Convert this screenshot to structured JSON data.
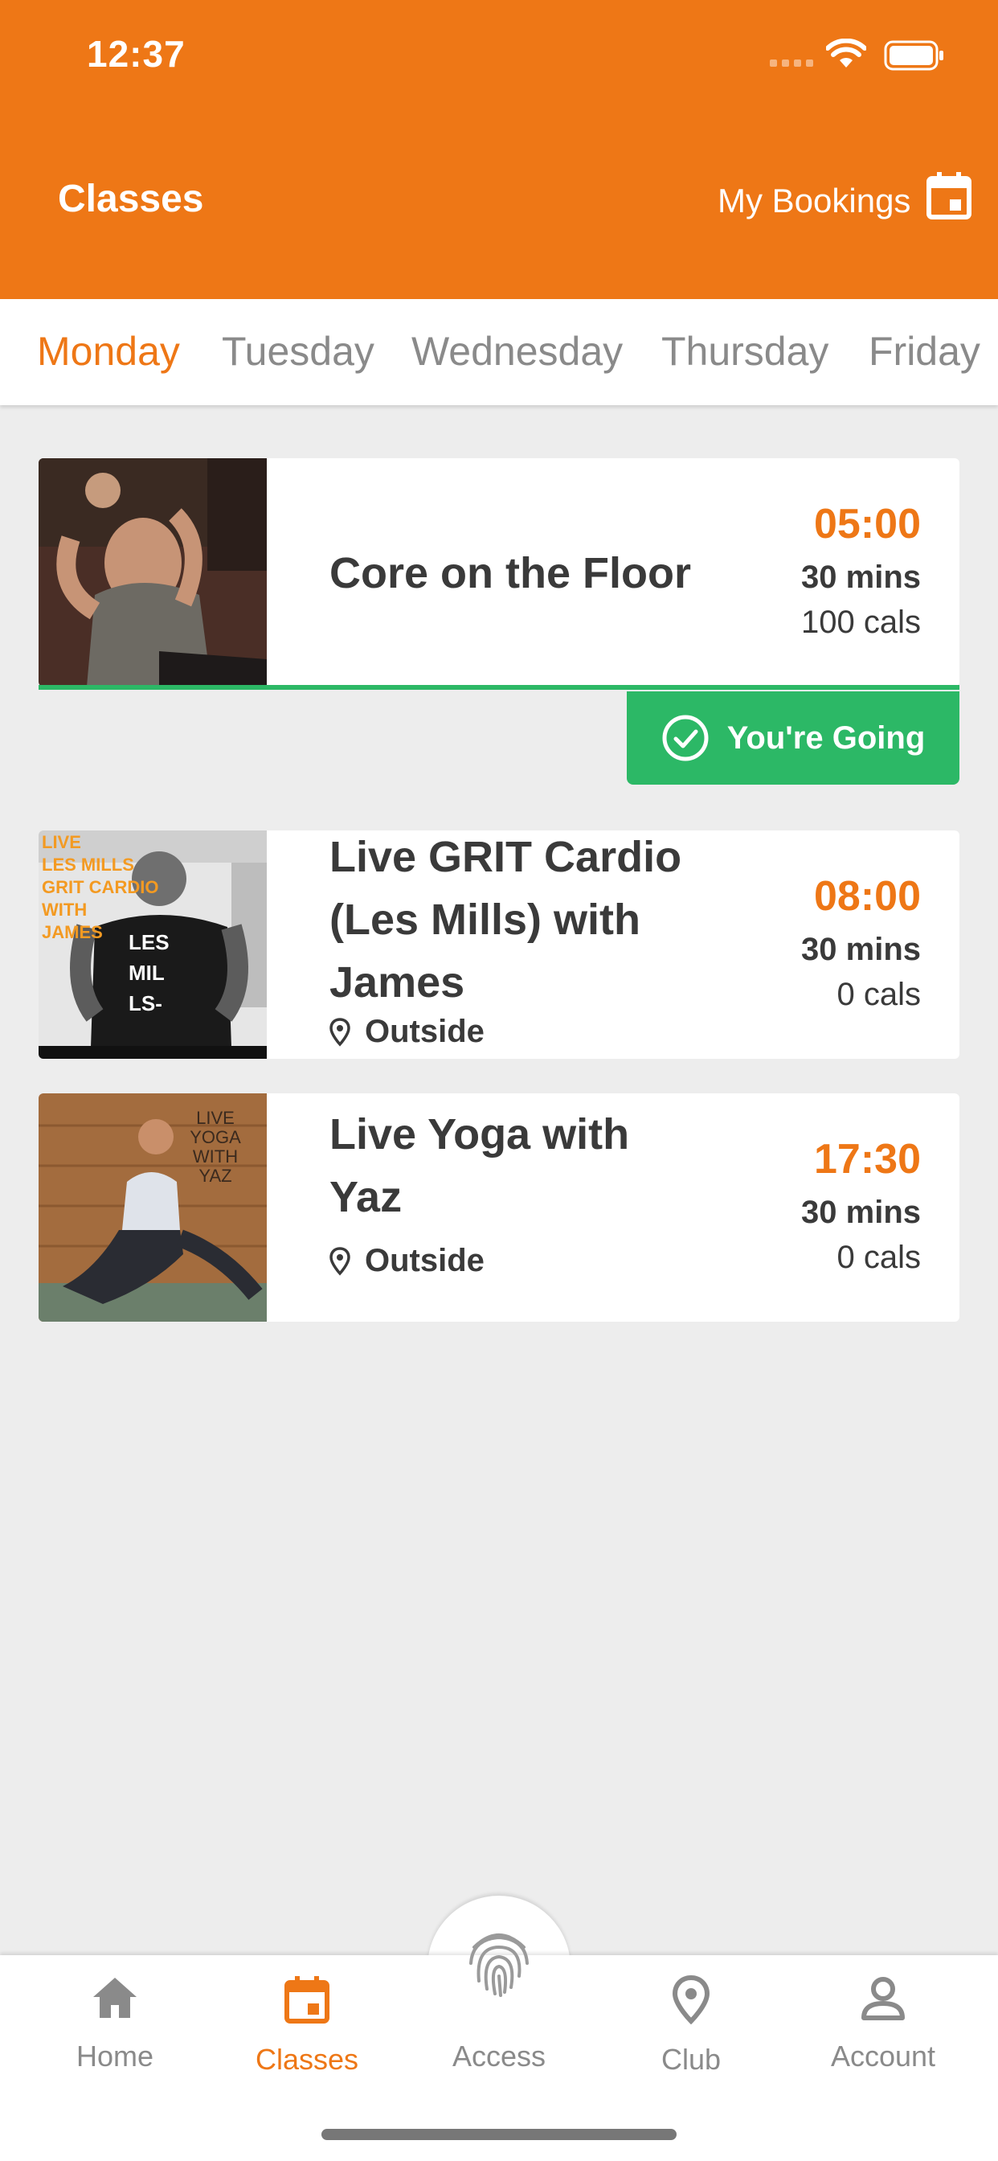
{
  "status_bar": {
    "time": "12:37"
  },
  "header": {
    "title": "Classes",
    "my_bookings_label": "My Bookings"
  },
  "day_tabs": [
    {
      "label": "Monday",
      "active": true
    },
    {
      "label": "Tuesday",
      "active": false
    },
    {
      "label": "Wednesday",
      "active": false
    },
    {
      "label": "Thursday",
      "active": false
    },
    {
      "label": "Friday",
      "active": false
    }
  ],
  "classes": [
    {
      "title": "Core on the Floor",
      "time": "05:00",
      "duration": "30 mins",
      "calories": "100 cals",
      "location": "",
      "status": "You're Going",
      "thumb_overlay_lines": []
    },
    {
      "title_lines": [
        "Live GRIT Cardio",
        "(Les Mills) with",
        "James"
      ],
      "time": "08:00",
      "duration": "30 mins",
      "calories": "0 cals",
      "location": "Outside",
      "thumb_overlay_lines": [
        "LIVE",
        "LES MILLS",
        "GRIT CARDIO",
        "WITH",
        "JAMES"
      ],
      "shirt_text": [
        "LES",
        "MIL",
        "LS-"
      ]
    },
    {
      "title_lines": [
        "Live Yoga with",
        "Yaz"
      ],
      "time": "17:30",
      "duration": "30 mins",
      "calories": "0 cals",
      "location": "Outside",
      "thumb_overlay_lines": [
        "LIVE",
        "YOGA",
        "WITH",
        "YAZ"
      ]
    }
  ],
  "bottom_nav": [
    {
      "label": "Home",
      "icon": "home-icon",
      "active": false
    },
    {
      "label": "Classes",
      "icon": "calendar-icon",
      "active": true
    },
    {
      "label": "Access",
      "icon": "fingerprint-icon",
      "active": false
    },
    {
      "label": "Club",
      "icon": "location-pin-icon",
      "active": false
    },
    {
      "label": "Account",
      "icon": "user-icon",
      "active": false
    }
  ],
  "colors": {
    "accent": "#ee7716",
    "going": "#2cb866",
    "background": "#ededed",
    "text": "#3a3a3a"
  }
}
